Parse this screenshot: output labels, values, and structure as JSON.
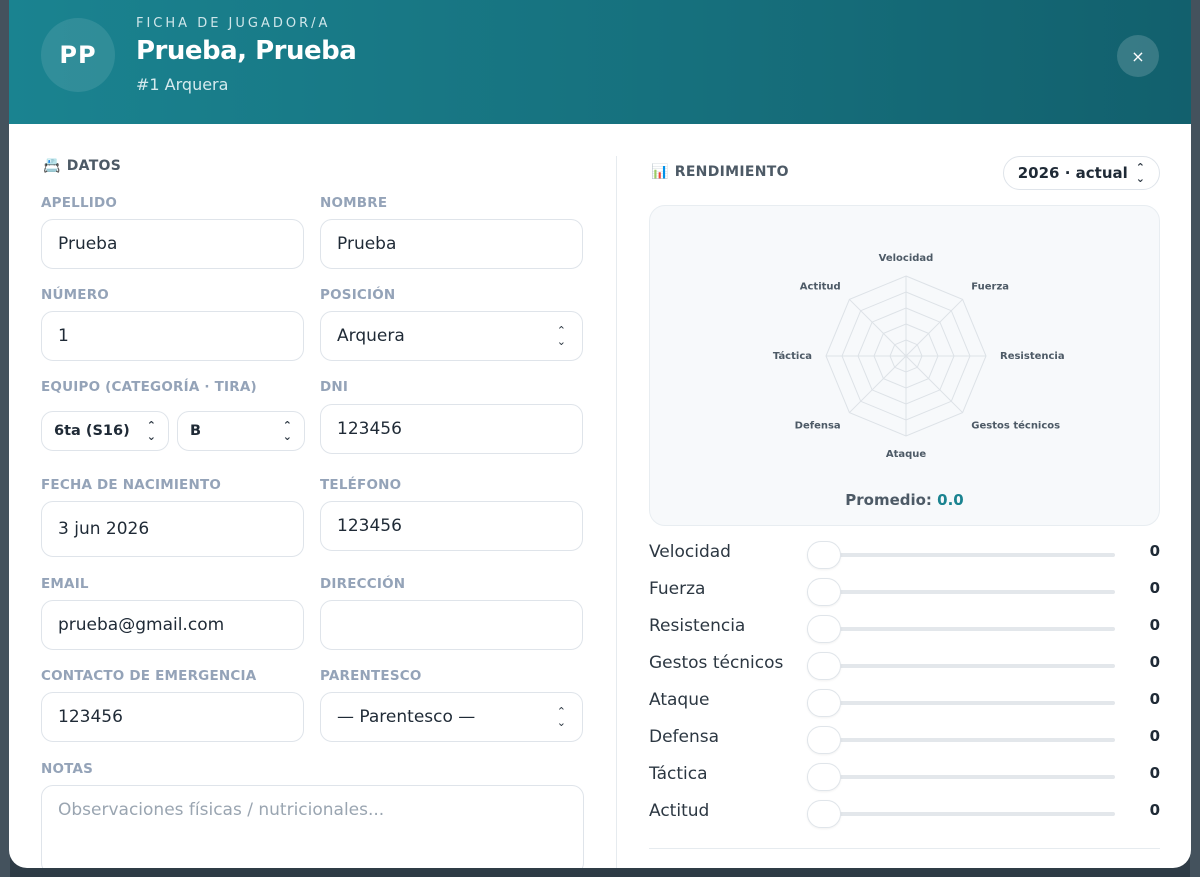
{
  "header": {
    "initials": "PP",
    "eyebrow": "FICHA DE JUGADOR/A",
    "title": "Prueba, Prueba",
    "subtitle": "#1 Arquera",
    "close": "×"
  },
  "datos": {
    "section_title": "DATOS",
    "section_icon": "📇",
    "fields": {
      "apellido": {
        "label": "APELLIDO",
        "value": "Prueba"
      },
      "nombre": {
        "label": "NOMBRE",
        "value": "Prueba"
      },
      "numero": {
        "label": "NÚMERO",
        "value": "1"
      },
      "posicion": {
        "label": "POSICIÓN",
        "value": "Arquera"
      },
      "equipo": {
        "label": "EQUIPO (CATEGORÍA · TIRA)",
        "categoria": "6ta (S16)",
        "tira": "B"
      },
      "dni": {
        "label": "DNI",
        "value": "123456"
      },
      "fecha_nacimiento": {
        "label": "FECHA DE NACIMIENTO",
        "value": "3 jun 2026"
      },
      "telefono": {
        "label": "TELÉFONO",
        "value": "123456"
      },
      "email": {
        "label": "EMAIL",
        "value": "prueba@gmail.com"
      },
      "direccion": {
        "label": "DIRECCIÓN",
        "value": ""
      },
      "contacto_emergencia": {
        "label": "CONTACTO DE EMERGENCIA",
        "value": "123456"
      },
      "parentesco": {
        "label": "PARENTESCO",
        "value": "— Parentesco —"
      },
      "notas": {
        "label": "NOTAS",
        "placeholder": "Observaciones físicas / nutricionales..."
      }
    }
  },
  "rendimiento": {
    "section_title": "RENDIMIENTO",
    "section_icon": "📊",
    "year": "2026 · actual",
    "radar_labels": [
      "Velocidad",
      "Fuerza",
      "Resistencia",
      "Gestos técnicos",
      "Ataque",
      "Defensa",
      "Táctica",
      "Actitud"
    ],
    "promedio_label": "Promedio:",
    "promedio_value": "0.0",
    "stats": [
      {
        "name": "Velocidad",
        "value": 0
      },
      {
        "name": "Fuerza",
        "value": 0
      },
      {
        "name": "Resistencia",
        "value": 0
      },
      {
        "name": "Gestos técnicos",
        "value": 0
      },
      {
        "name": "Ataque",
        "value": 0
      },
      {
        "name": "Defensa",
        "value": 0
      },
      {
        "name": "Táctica",
        "value": 0
      },
      {
        "name": "Actitud",
        "value": 0
      }
    ]
  },
  "colors": {
    "accent": "#1a8390",
    "header_dark": "#12606d"
  }
}
